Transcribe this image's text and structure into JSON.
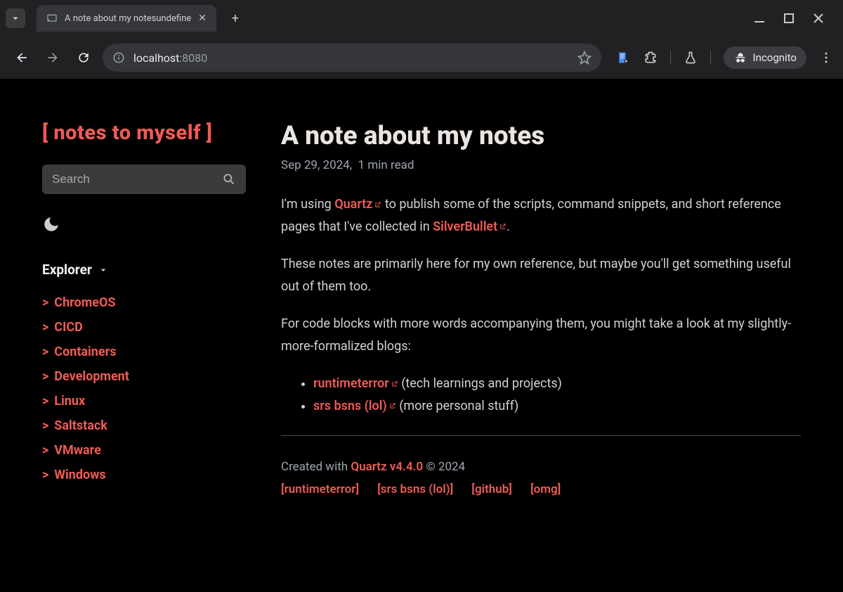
{
  "browser": {
    "tab_title": "A note about my notesundefine",
    "url_host": "localhost",
    "url_port": ":8080",
    "incognito_label": "Incognito"
  },
  "sidebar": {
    "site_title": "[ notes to myself ]",
    "search_placeholder": "Search",
    "explorer_label": "Explorer",
    "items": [
      {
        "label": "ChromeOS"
      },
      {
        "label": "CICD"
      },
      {
        "label": "Containers"
      },
      {
        "label": "Development"
      },
      {
        "label": "Linux"
      },
      {
        "label": "Saltstack"
      },
      {
        "label": "VMware"
      },
      {
        "label": "Windows"
      }
    ]
  },
  "article": {
    "title": "A note about my notes",
    "date": "Sep 29, 2024,",
    "read_time": "1 min read",
    "p1_a": "I'm using ",
    "link_quartz": "Quartz",
    "p1_b": " to publish some of the scripts, command snippets, and short reference pages that I've collected in ",
    "link_silverbullet": "SilverBullet",
    "p1_c": ".",
    "p2": "These notes are primarily here for my own reference, but maybe you'll get something useful out of them too.",
    "p3": "For code blocks with more words accompanying them, you might take a look at my slightly-more-formalized blogs:",
    "blog_links": [
      {
        "label": "runtimeterror",
        "desc": " (tech learnings and projects)"
      },
      {
        "label": "srs bsns (lol)",
        "desc": " (more personal stuff)"
      }
    ],
    "footer_created": "Created with ",
    "footer_quartz": "Quartz v4.4.0",
    "footer_copyright": " © 2024",
    "footer_nav": [
      {
        "label": "[runtimeterror]"
      },
      {
        "label": "[srs bsns (lol)]"
      },
      {
        "label": "[github]"
      },
      {
        "label": "[omg]"
      }
    ]
  }
}
